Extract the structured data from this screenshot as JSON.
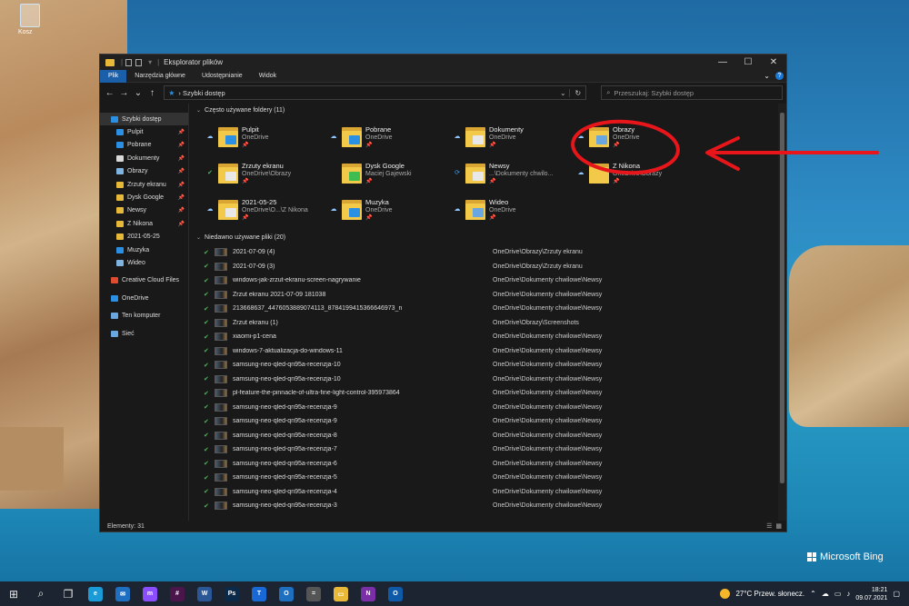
{
  "desktop": {
    "recycle_label": "Kosz",
    "bing_label": "Microsoft Bing"
  },
  "window": {
    "title": "Eksplorator plików",
    "controls": [
      "—",
      "☐",
      "✕"
    ],
    "ribbon_tabs": [
      "Plik",
      "Narzędzia główne",
      "Udostępnianie",
      "Widok"
    ],
    "address": "Szybki dostęp",
    "search_placeholder": "Przeszukaj: Szybki dostęp"
  },
  "sidebar": {
    "items": [
      {
        "label": "Szybki dostęp",
        "color": "#2b8fe4",
        "pinned": false,
        "level": "top",
        "selected": true
      },
      {
        "label": "Pulpit",
        "color": "#2b8fe4",
        "pinned": true,
        "level": "sub"
      },
      {
        "label": "Pobrane",
        "color": "#2b8fe4",
        "pinned": true,
        "level": "sub"
      },
      {
        "label": "Dokumenty",
        "color": "#d9d9d9",
        "pinned": true,
        "level": "sub"
      },
      {
        "label": "Obrazy",
        "color": "#7fb3e0",
        "pinned": true,
        "level": "sub"
      },
      {
        "label": "Zrzuty ekranu",
        "color": "#e8b938",
        "pinned": true,
        "level": "sub"
      },
      {
        "label": "Dysk Google",
        "color": "#e8b938",
        "pinned": true,
        "level": "sub"
      },
      {
        "label": "Newsy",
        "color": "#e8b938",
        "pinned": true,
        "level": "sub"
      },
      {
        "label": "Z Nikona",
        "color": "#e8b938",
        "pinned": true,
        "level": "sub"
      },
      {
        "label": "2021-05-25",
        "color": "#e8b938",
        "pinned": false,
        "level": "sub"
      },
      {
        "label": "Muzyka",
        "color": "#2b8fe4",
        "pinned": false,
        "level": "sub"
      },
      {
        "label": "Wideo",
        "color": "#7fb3e0",
        "pinned": false,
        "level": "sub"
      },
      {
        "label": "Creative Cloud Files",
        "color": "#e04a2f",
        "pinned": false,
        "level": "top",
        "gap": true
      },
      {
        "label": "OneDrive",
        "color": "#2b8fe4",
        "pinned": false,
        "level": "top",
        "gap": true
      },
      {
        "label": "Ten komputer",
        "color": "#6aa7e0",
        "pinned": false,
        "level": "top",
        "gap": true
      },
      {
        "label": "Sieć",
        "color": "#6aa7e0",
        "pinned": false,
        "level": "top",
        "gap": true
      }
    ]
  },
  "frequent": {
    "header": "Często używane foldery (11)",
    "folders": [
      {
        "name": "Pulpit",
        "location": "OneDrive",
        "status": "☁",
        "badge": "#2b8fe4"
      },
      {
        "name": "Pobrane",
        "location": "OneDrive",
        "status": "☁",
        "badge": "#2b8fe4"
      },
      {
        "name": "Dokumenty",
        "location": "OneDrive",
        "status": "☁",
        "badge": "#e8e8e8"
      },
      {
        "name": "Obrazy",
        "location": "OneDrive",
        "status": "☁",
        "badge": "#6aa7e0"
      },
      {
        "name": "Zrzuty ekranu",
        "location": "OneDrive\\Obrazy",
        "status": "✔",
        "badge": "#e8e8e8"
      },
      {
        "name": "Dysk Google",
        "location": "Maciej Gajewski",
        "status": "",
        "badge": "#3fbd51"
      },
      {
        "name": "Newsy",
        "location": "...\\Dokumenty chwilo...",
        "status": "⟳",
        "badge": "#e8e8e8"
      },
      {
        "name": "Z Nikona",
        "location": "OneDrive\\Obrazy",
        "status": "☁",
        "badge": ""
      },
      {
        "name": "2021-05-25",
        "location": "OneDrive\\O...\\Z Nikona",
        "status": "☁",
        "badge": "#e8e8e8"
      },
      {
        "name": "Muzyka",
        "location": "OneDrive",
        "status": "☁",
        "badge": "#2b8fe4"
      },
      {
        "name": "Wideo",
        "location": "OneDrive",
        "status": "☁",
        "badge": "#6aa7e0"
      }
    ]
  },
  "recent": {
    "header": "Niedawno używane pliki (20)",
    "files": [
      {
        "name": "2021-07-09 (4)",
        "path": "OneDrive\\Obrazy\\Zrzuty ekranu"
      },
      {
        "name": "2021-07-09 (3)",
        "path": "OneDrive\\Obrazy\\Zrzuty ekranu"
      },
      {
        "name": "windows-jak-zrzut-ekranu-screen-nagrywanie",
        "path": "OneDrive\\Dokumenty chwilowe\\Newsy"
      },
      {
        "name": "Zrzut ekranu 2021-07-09 181038",
        "path": "OneDrive\\Dokumenty chwilowe\\Newsy"
      },
      {
        "name": "213668637_4476053889074113_8784199415366646973_n",
        "path": "OneDrive\\Dokumenty chwilowe\\Newsy"
      },
      {
        "name": "Zrzut ekranu (1)",
        "path": "OneDrive\\Obrazy\\Screenshots"
      },
      {
        "name": "xiaomi-p1-cena",
        "path": "OneDrive\\Dokumenty chwilowe\\Newsy"
      },
      {
        "name": "windows-7-aktualizacja-do-windows-11",
        "path": "OneDrive\\Dokumenty chwilowe\\Newsy"
      },
      {
        "name": "samsung-neo-qled-qn95a-recenzja-10",
        "path": "OneDrive\\Dokumenty chwilowe\\Newsy"
      },
      {
        "name": "samsung-neo-qled-qn95a-recenzja-10",
        "path": "OneDrive\\Dokumenty chwilowe\\Newsy"
      },
      {
        "name": "pl-feature-the-pinnacle-of-ultra-fine-light-control-395973864",
        "path": "OneDrive\\Dokumenty chwilowe\\Newsy"
      },
      {
        "name": "samsung-neo-qled-qn95a-recenzja-9",
        "path": "OneDrive\\Dokumenty chwilowe\\Newsy"
      },
      {
        "name": "samsung-neo-qled-qn95a-recenzja-9",
        "path": "OneDrive\\Dokumenty chwilowe\\Newsy"
      },
      {
        "name": "samsung-neo-qled-qn95a-recenzja-8",
        "path": "OneDrive\\Dokumenty chwilowe\\Newsy"
      },
      {
        "name": "samsung-neo-qled-qn95a-recenzja-7",
        "path": "OneDrive\\Dokumenty chwilowe\\Newsy"
      },
      {
        "name": "samsung-neo-qled-qn95a-recenzja-6",
        "path": "OneDrive\\Dokumenty chwilowe\\Newsy"
      },
      {
        "name": "samsung-neo-qled-qn95a-recenzja-5",
        "path": "OneDrive\\Dokumenty chwilowe\\Newsy"
      },
      {
        "name": "samsung-neo-qled-qn95a-recenzja-4",
        "path": "OneDrive\\Dokumenty chwilowe\\Newsy"
      },
      {
        "name": "samsung-neo-qled-qn95a-recenzja-3",
        "path": "OneDrive\\Dokumenty chwilowe\\Newsy"
      }
    ]
  },
  "status": {
    "count": "Elementy: 31"
  },
  "taskbar": {
    "apps": [
      {
        "name": "edge",
        "color": "#1a9bd7",
        "glyph": "e"
      },
      {
        "name": "mail",
        "color": "#1f6fc1",
        "glyph": "✉"
      },
      {
        "name": "messenger",
        "color": "#8a4dff",
        "glyph": "m"
      },
      {
        "name": "slack",
        "color": "#4a154b",
        "glyph": "#"
      },
      {
        "name": "word",
        "color": "#2b5797",
        "glyph": "W"
      },
      {
        "name": "photoshop",
        "color": "#0b2a4a",
        "glyph": "Ps"
      },
      {
        "name": "trello",
        "color": "#1868d6",
        "glyph": "T"
      },
      {
        "name": "outlook",
        "color": "#1f6fc1",
        "glyph": "O"
      },
      {
        "name": "calculator",
        "color": "#555",
        "glyph": "="
      },
      {
        "name": "explorer",
        "color": "#e8b938",
        "glyph": "▭"
      },
      {
        "name": "onenote",
        "color": "#7b2fa6",
        "glyph": "N"
      },
      {
        "name": "outlook-2",
        "color": "#0f5aa8",
        "glyph": "O"
      }
    ],
    "weather": "27°C  Przew. słonecz.",
    "time": "18:21",
    "date": "09.07.2021"
  }
}
